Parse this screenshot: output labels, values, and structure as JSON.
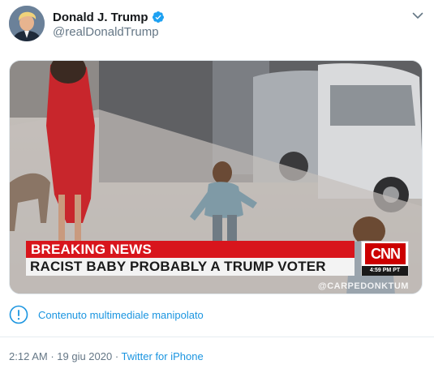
{
  "tweet": {
    "author_name": "Donald J. Trump",
    "handle": "@realDonaldTrump",
    "media": {
      "breaking_label": "BREAKING NEWS",
      "headline": "RACIST BABY PROBABLY A TRUMP VOTER",
      "network_logo": "CNN",
      "timestamp_overlay": "4:59 PM PT",
      "watermark": "@CARPEDONKTUM"
    },
    "manipulated_notice": "Contenuto multimediale manipolato",
    "meta": {
      "time": "2:12 AM",
      "separator": " · ",
      "date": "19 giu 2020",
      "source": "Twitter for iPhone"
    }
  },
  "colors": {
    "link_blue": "#1b95e0",
    "verified_blue": "#1da1f2",
    "muted": "#657786",
    "cnn_red": "#cc0000",
    "banner_red": "#d8151c"
  },
  "icons": [
    "verified-badge-icon",
    "chevron-down-icon",
    "info-circle-icon"
  ]
}
